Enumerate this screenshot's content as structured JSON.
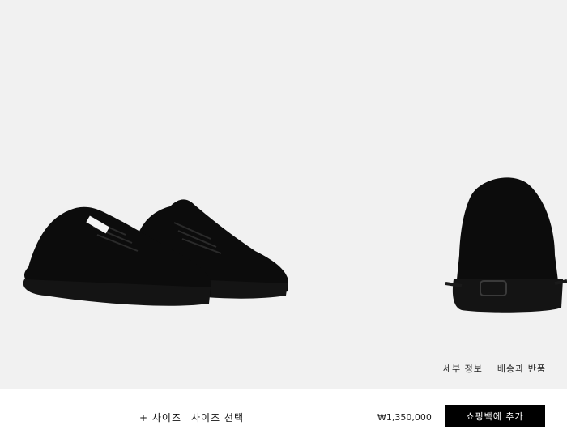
{
  "gallery": {
    "images": [
      {
        "icon": "sneaker-pair-side-view"
      },
      {
        "icon": "sneaker-back-view"
      }
    ],
    "shoe_color": "#0c0c0c",
    "sole_color": "#141414",
    "background": "#f1f1f1"
  },
  "info_links": {
    "details": "세부 정보",
    "shipping": "배송과 반품"
  },
  "bottom_bar": {
    "size_label": "+ 사이즈",
    "size_placeholder": "사이즈 선택",
    "price": "₩1,350,000",
    "add_to_bag": "쇼핑백에 추가"
  }
}
